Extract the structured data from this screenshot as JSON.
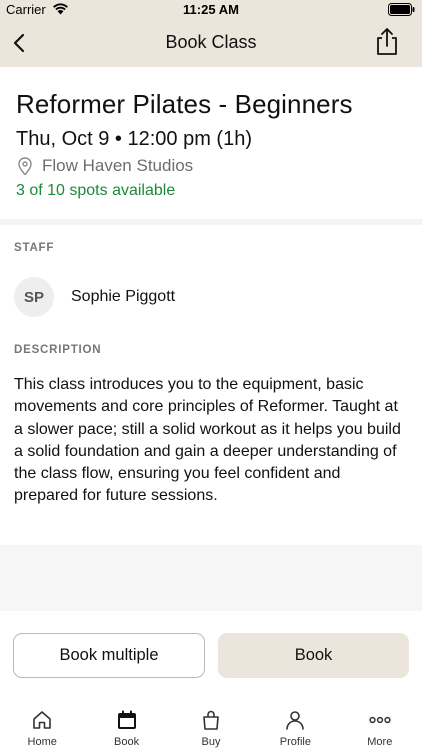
{
  "status_bar": {
    "carrier": "Carrier",
    "time": "11:25 AM"
  },
  "nav": {
    "title": "Book Class"
  },
  "class": {
    "title": "Reformer Pilates - Beginners",
    "datetime": "Thu, Oct 9 • 12:00 pm (1h)",
    "location": "Flow Haven Studios",
    "spots": "3 of 10 spots available"
  },
  "staff": {
    "section_label": "STAFF",
    "initials": "SP",
    "name": "Sophie Piggott"
  },
  "description": {
    "section_label": "DESCRIPTION",
    "text": "This class introduces you to the equipment, basic movements and core principles of Reformer. Taught at a slower pace; still a solid workout as it helps you build a solid foundation and gain a deeper understanding of the class flow, ensuring you feel confident and prepared for future sessions."
  },
  "actions": {
    "book_multiple": "Book multiple",
    "book": "Book"
  },
  "tabs": [
    {
      "label": "Home",
      "icon": "home-icon"
    },
    {
      "label": "Book",
      "icon": "calendar-icon"
    },
    {
      "label": "Buy",
      "icon": "bag-icon"
    },
    {
      "label": "Profile",
      "icon": "profile-icon"
    },
    {
      "label": "More",
      "icon": "more-icon"
    }
  ],
  "colors": {
    "header_bg": "#ece5dc",
    "available_green": "#1c8a3a",
    "book_button_bg": "#ece5dc"
  }
}
